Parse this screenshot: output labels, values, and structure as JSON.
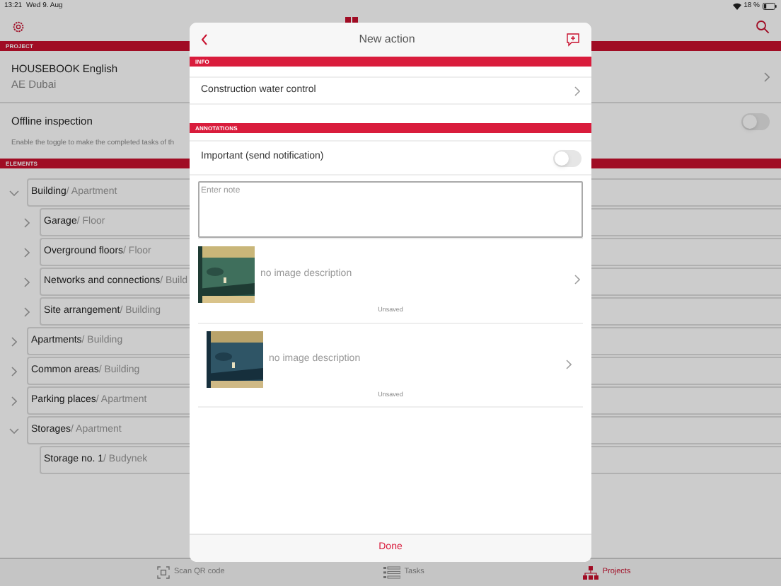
{
  "status_bar": {
    "time": "13:21",
    "date": "Wed 9. Aug",
    "battery": "18 %"
  },
  "project_section": {
    "header": "PROJECT",
    "project_name": "HOUSEBOOK English",
    "location": "AE Dubai",
    "offline_inspection": {
      "label": "Offline inspection",
      "on": false
    },
    "hint": "Enable the toggle to make the completed tasks of th"
  },
  "elements": {
    "header": "ELEMENTS",
    "items": [
      {
        "name": "Building",
        "type": "/ Apartment",
        "kind": "group",
        "expanded": true,
        "children": [
          {
            "name": "Garage",
            "type": "/ Floor",
            "kind": "group",
            "expanded": false
          },
          {
            "name": "Overground floors",
            "type": "/ Floor",
            "kind": "group",
            "expanded": false
          },
          {
            "name": "Networks and connections",
            "type": "/ Build",
            "kind": "group",
            "expanded": false
          },
          {
            "name": "Site arrangement",
            "type": "/ Building",
            "kind": "group",
            "expanded": false
          }
        ]
      },
      {
        "name": "Apartments",
        "type": "/ Building",
        "kind": "group",
        "expanded": false
      },
      {
        "name": "Common areas",
        "type": "/ Building",
        "kind": "group",
        "expanded": false
      },
      {
        "name": "Parking places",
        "type": "/ Apartment",
        "kind": "group",
        "expanded": false
      },
      {
        "name": "Storages",
        "type": "/ Apartment",
        "kind": "group",
        "expanded": true,
        "children": [
          {
            "name": "Storage no. 1",
            "type": "/ Budynek",
            "kind": "leaf"
          }
        ]
      }
    ]
  },
  "tab_bar": [
    {
      "label": "Scan QR code",
      "kind": "scan",
      "selected": false
    },
    {
      "label": "Tasks",
      "kind": "tasks",
      "selected": false
    },
    {
      "label": "Projects",
      "kind": "projects",
      "selected": true
    }
  ],
  "modal": {
    "title": "New action",
    "info_header": "INFO",
    "info_value": "Construction water control",
    "annotations_header": "ANNOTATIONS",
    "important": {
      "label": "Important (send notification)",
      "on": false
    },
    "note": {
      "placeholder": "Enter note"
    },
    "photos": [
      {
        "kind": "picture",
        "description": "no image description",
        "status": "Unsaved"
      },
      {
        "kind": "picture",
        "description": "no image description",
        "status": "Unsaved"
      }
    ],
    "done": "Done"
  }
}
